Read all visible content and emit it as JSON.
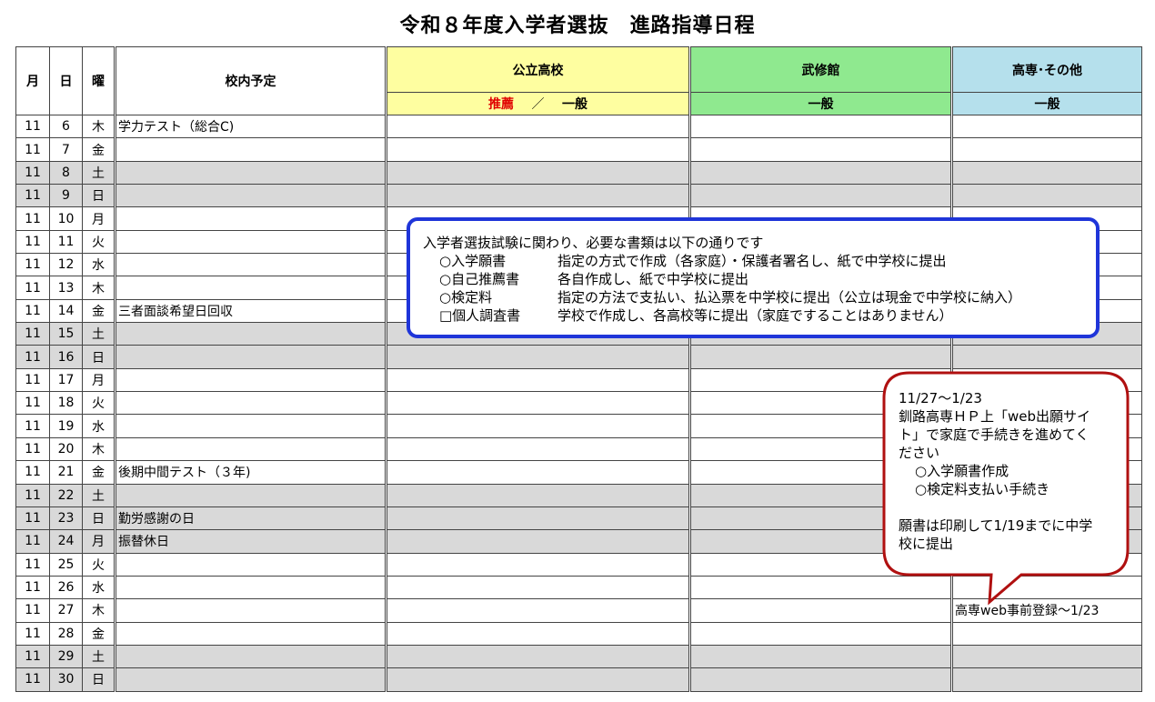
{
  "title": "令和８年度入学者選抜　進路指導日程",
  "header": {
    "month": "月",
    "day": "日",
    "weekday": "曜",
    "school_events": "校内予定",
    "koritsu": "公立高校",
    "koritsu_sub_red": "推薦",
    "koritsu_sub_sep": "／",
    "koritsu_sub_rest": "一般",
    "bushukan": "武修館",
    "bushukan_sub": "一般",
    "kosen": "高専･その他",
    "kosen_sub": "一般"
  },
  "colors": {
    "koritsu": "#fefea0",
    "bushukan": "#8fe98f",
    "kosen": "#b5e0ec",
    "weekend": "#d9d9d9",
    "notice_border": "#1f35d9",
    "bubble_border": "#b01010",
    "red_text": "#e00000"
  },
  "rows": [
    {
      "m": "11",
      "d": "6",
      "w": "木",
      "event": "学力テスト（総合C)",
      "kosen": "",
      "weekend": false
    },
    {
      "m": "11",
      "d": "7",
      "w": "金",
      "event": "",
      "kosen": "",
      "weekend": false
    },
    {
      "m": "11",
      "d": "8",
      "w": "土",
      "event": "",
      "kosen": "",
      "weekend": true
    },
    {
      "m": "11",
      "d": "9",
      "w": "日",
      "event": "",
      "kosen": "",
      "weekend": true
    },
    {
      "m": "11",
      "d": "10",
      "w": "月",
      "event": "",
      "kosen": "",
      "weekend": false
    },
    {
      "m": "11",
      "d": "11",
      "w": "火",
      "event": "",
      "kosen": "",
      "weekend": false
    },
    {
      "m": "11",
      "d": "12",
      "w": "水",
      "event": "",
      "kosen": "",
      "weekend": false
    },
    {
      "m": "11",
      "d": "13",
      "w": "木",
      "event": "",
      "kosen": "",
      "weekend": false
    },
    {
      "m": "11",
      "d": "14",
      "w": "金",
      "event": "三者面談希望日回収",
      "kosen": "",
      "weekend": false
    },
    {
      "m": "11",
      "d": "15",
      "w": "土",
      "event": "",
      "kosen": "",
      "weekend": true
    },
    {
      "m": "11",
      "d": "16",
      "w": "日",
      "event": "",
      "kosen": "",
      "weekend": true
    },
    {
      "m": "11",
      "d": "17",
      "w": "月",
      "event": "",
      "kosen": "",
      "weekend": false
    },
    {
      "m": "11",
      "d": "18",
      "w": "火",
      "event": "",
      "kosen": "",
      "weekend": false
    },
    {
      "m": "11",
      "d": "19",
      "w": "水",
      "event": "",
      "kosen": "",
      "weekend": false
    },
    {
      "m": "11",
      "d": "20",
      "w": "木",
      "event": "",
      "kosen": "",
      "weekend": false
    },
    {
      "m": "11",
      "d": "21",
      "w": "金",
      "event": "後期中間テスト（３年)",
      "kosen": "",
      "weekend": false
    },
    {
      "m": "11",
      "d": "22",
      "w": "土",
      "event": "",
      "kosen": "",
      "weekend": true
    },
    {
      "m": "11",
      "d": "23",
      "w": "日",
      "event": "勤労感謝の日",
      "kosen": "",
      "weekend": true
    },
    {
      "m": "11",
      "d": "24",
      "w": "月",
      "event": "振替休日",
      "kosen": "",
      "weekend": true
    },
    {
      "m": "11",
      "d": "25",
      "w": "火",
      "event": "",
      "kosen": "",
      "weekend": false
    },
    {
      "m": "11",
      "d": "26",
      "w": "水",
      "event": "",
      "kosen": "",
      "weekend": false
    },
    {
      "m": "11",
      "d": "27",
      "w": "木",
      "event": "",
      "kosen": "高専web事前登録～1/23",
      "weekend": false
    },
    {
      "m": "11",
      "d": "28",
      "w": "金",
      "event": "",
      "kosen": "",
      "weekend": false
    },
    {
      "m": "11",
      "d": "29",
      "w": "土",
      "event": "",
      "kosen": "",
      "weekend": true
    },
    {
      "m": "11",
      "d": "30",
      "w": "日",
      "event": "",
      "kosen": "",
      "weekend": true
    }
  ],
  "notice": {
    "intro": "入学者選抜試験に関わり、必要な書類は以下の通りです",
    "items": [
      {
        "name": "○入学願書",
        "desc": "指定の方式で作成（各家庭）・保護者署名し、紙で中学校に提出"
      },
      {
        "name": "○自己推薦書",
        "desc": "各自作成し、紙で中学校に提出"
      },
      {
        "name": "○検定料",
        "desc": "指定の方法で支払い、払込票を中学校に提出（公立は現金で中学校に納入）"
      },
      {
        "name": "□個人調査書",
        "desc": "学校で作成し、各高校等に提出（家庭ですることはありません）"
      }
    ]
  },
  "bubble": {
    "date": "11/27～1/23",
    "line1": "釧路高専ＨＰ上「web出願サイ",
    "line2": "ト」で家庭で手続きを進めてく",
    "line3": "ださい",
    "item1": "○入学願書作成",
    "item2": "○検定料支払い手続き",
    "note1": "願書は印刷して1/19までに中学",
    "note2": "校に提出"
  }
}
